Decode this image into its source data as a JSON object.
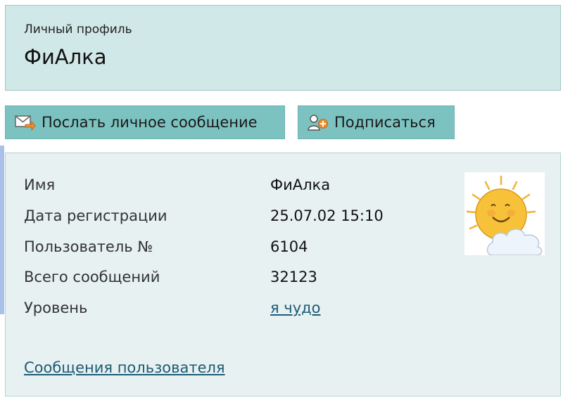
{
  "header": {
    "subtitle": "Личный профиль",
    "title": "ФиАлка"
  },
  "actions": {
    "message_label": "Послать личное сообщение",
    "subscribe_label": "Подписаться"
  },
  "profile": {
    "rows": [
      {
        "label": "Имя",
        "value": "ФиАлка"
      },
      {
        "label": "Дата регистрации",
        "value": "25.07.02 15:10"
      },
      {
        "label": "Пользователь №",
        "value": "6104"
      },
      {
        "label": "Всего сообщений",
        "value": "32123"
      },
      {
        "label": "Уровень",
        "value": "я чудо"
      }
    ],
    "user_posts_link": "Сообщения пользователя"
  },
  "icons": {
    "message": "envelope-icon",
    "subscribe": "add-user-icon",
    "avatar": "sun-avatar-icon"
  },
  "colors": {
    "header_bg": "#d1e8e8",
    "button_bg": "#7cc2c1",
    "panel_bg": "#e7f1f1",
    "link": "#1c5b74",
    "accent": "#a9c1e8"
  }
}
